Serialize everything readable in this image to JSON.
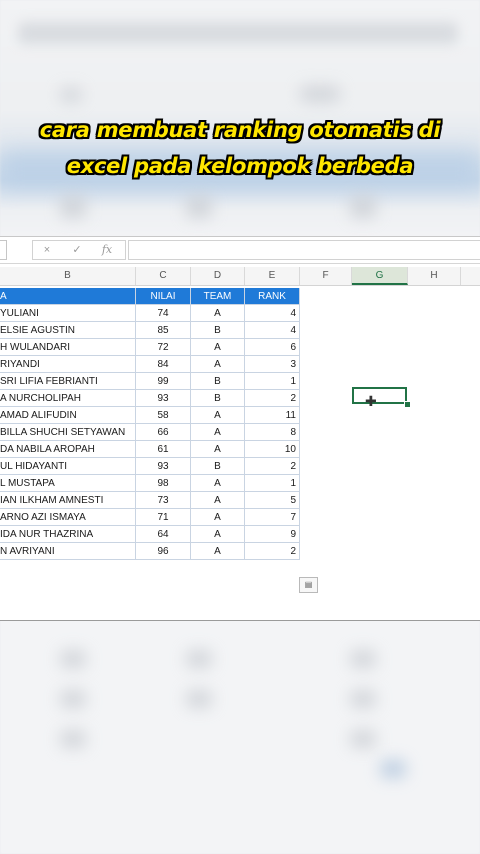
{
  "caption": {
    "line1": "cara membuat ranking otomatis di",
    "line2": "excel pada kelompok berbeda"
  },
  "formula_bar": {
    "cancel_icon": "×",
    "enter_icon": "✓",
    "fx_label": "fx",
    "value": ""
  },
  "columns": [
    "B",
    "C",
    "D",
    "E",
    "F",
    "G",
    "H"
  ],
  "selected_column": "G",
  "table": {
    "headers": [
      "A",
      "NILAI",
      "TEAM",
      "RANK"
    ],
    "rows": [
      [
        "YULIANI",
        "74",
        "A",
        "4"
      ],
      [
        "ELSIE AGUSTIN",
        "85",
        "B",
        "4"
      ],
      [
        "H WULANDARI",
        "72",
        "A",
        "6"
      ],
      [
        "RIYANDI",
        "84",
        "A",
        "3"
      ],
      [
        "SRI LIFIA FEBRIANTI",
        "99",
        "B",
        "1"
      ],
      [
        "A NURCHOLIPAH",
        "93",
        "B",
        "2"
      ],
      [
        "AMAD ALIFUDIN",
        "58",
        "A",
        "11"
      ],
      [
        "BILLA SHUCHI SETYAWAN",
        "66",
        "A",
        "8"
      ],
      [
        "DA NABILA AROPAH",
        "61",
        "A",
        "10"
      ],
      [
        "UL HIDAYANTI",
        "93",
        "B",
        "2"
      ],
      [
        "L MUSTAPA",
        "98",
        "A",
        "1"
      ],
      [
        "IAN ILKHAM AMNESTI",
        "73",
        "A",
        "5"
      ],
      [
        "ARNO AZI ISMAYA",
        "71",
        "A",
        "7"
      ],
      [
        "IDA NUR THAZRINA",
        "64",
        "A",
        "9"
      ],
      [
        "N AVRIYANI",
        "96",
        "A",
        "2"
      ]
    ]
  },
  "icons": {
    "cursor": "cross-cursor-icon",
    "paste_options": "paste-options-icon"
  }
}
